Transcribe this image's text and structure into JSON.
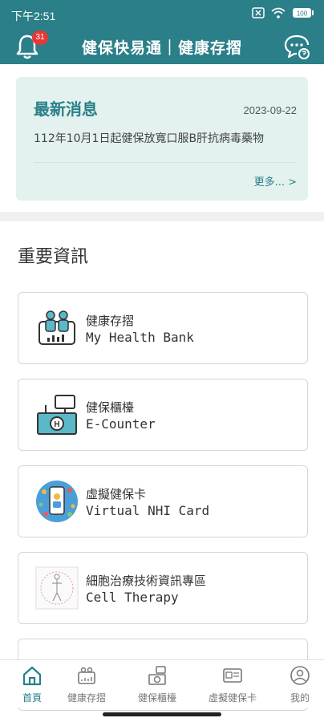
{
  "status": {
    "time": "下午2:51",
    "battery": "100"
  },
  "header": {
    "title": "健保快易通｜健康存摺",
    "notification_count": "31"
  },
  "news": {
    "heading": "最新消息",
    "date": "2023-09-22",
    "item": "112年10月1日起健保放寬口服B肝抗病毒藥物",
    "more": "更多... >"
  },
  "section": {
    "title": "重要資訊"
  },
  "cards": [
    {
      "zh": "健康存摺",
      "en": "My Health Bank",
      "icon": "health-bank-icon"
    },
    {
      "zh": "健保櫃檯",
      "en": "E-Counter",
      "icon": "e-counter-icon"
    },
    {
      "zh": "虛擬健保卡",
      "en": "Virtual NHI Card",
      "icon": "virtual-card-icon"
    },
    {
      "zh": "細胞治療技術資訊專區",
      "en": "Cell Therapy",
      "icon": "cell-therapy-icon"
    }
  ],
  "tabs": [
    {
      "label": "首頁",
      "active": true
    },
    {
      "label": "健康存摺"
    },
    {
      "label": "健保櫃檯"
    },
    {
      "label": "虛擬健保卡"
    },
    {
      "label": "我的"
    }
  ],
  "colors": {
    "brand": "#2a7f88",
    "news_bg": "#e3f2ef",
    "badge": "#e53935"
  }
}
